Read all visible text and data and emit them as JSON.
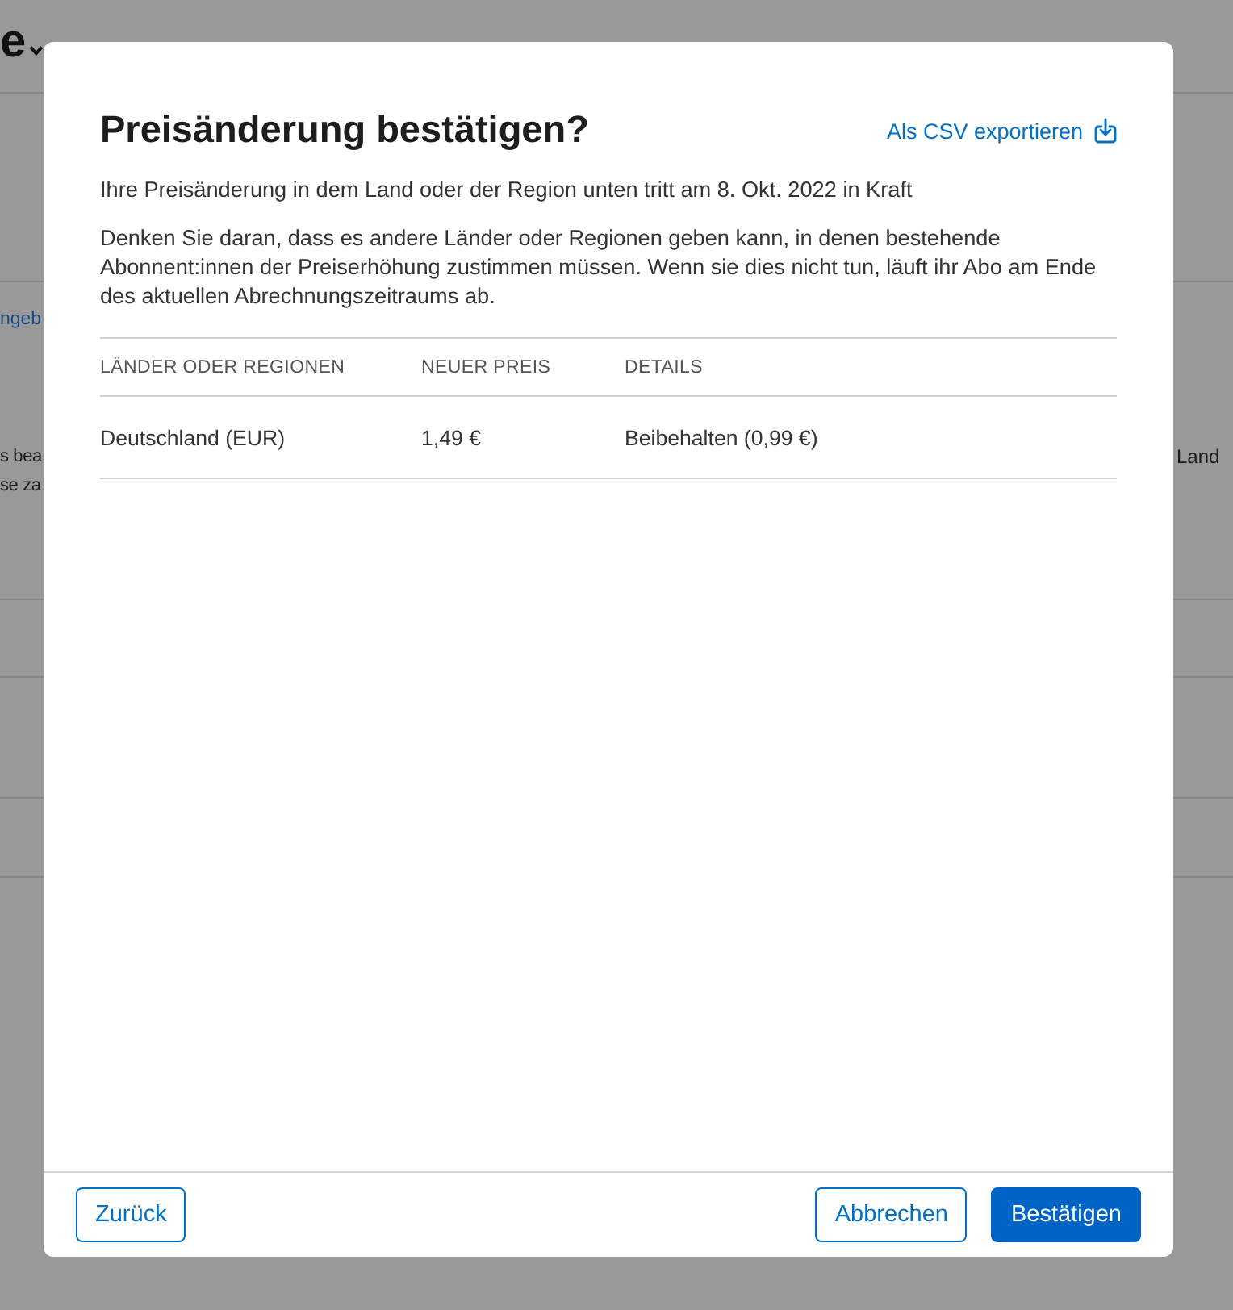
{
  "background": {
    "title": "e",
    "link": "ngeb",
    "left_lines": [
      "s bea",
      "se za"
    ],
    "right_text": "Land"
  },
  "dialog": {
    "title": "Preisänderung bestätigen?",
    "export_link": "Als CSV exportieren",
    "paragraphs": [
      "Ihre Preisänderung in dem Land oder der Region unten tritt am 8. Okt. 2022 in Kraft",
      "Denken Sie daran, dass es andere Länder oder Regionen geben kann, in denen bestehende Abonnent:innen der Preiserhöhung zustimmen müssen. Wenn sie dies nicht tun, läuft ihr Abo am Ende des aktuellen Abrechnungszeitraums ab."
    ],
    "table": {
      "columns": [
        "LÄNDER ODER REGIONEN",
        "NEUER PREIS",
        "DETAILS"
      ],
      "rows": [
        [
          "Deutschland (EUR)",
          "1,49 €",
          "Beibehalten (0,99 €)"
        ]
      ]
    },
    "footer": {
      "left_buttons": [
        {
          "label": "Zurück",
          "kind": "secondary"
        }
      ],
      "right_buttons": [
        {
          "label": "Abbrechen",
          "kind": "secondary"
        },
        {
          "label": "Bestätigen",
          "kind": "primary"
        }
      ]
    }
  }
}
